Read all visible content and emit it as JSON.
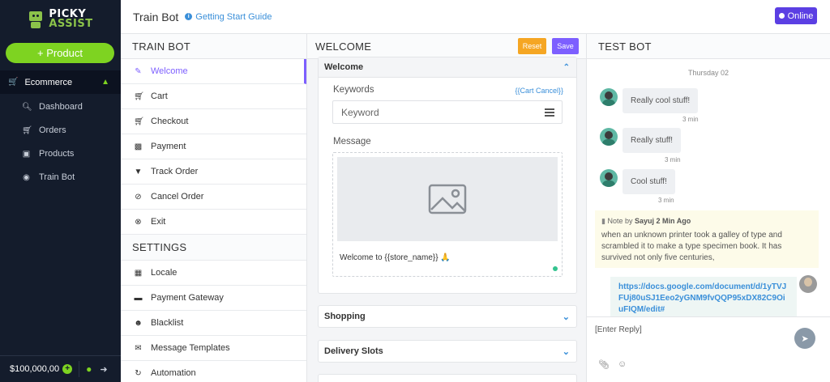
{
  "sidebar": {
    "brand_line1": "PICKY",
    "brand_line2": "ASSIST",
    "add_product_label": "+ Product",
    "section_label": "Ecommerce",
    "items": [
      {
        "label": "Dashboard",
        "icon": "search-icon"
      },
      {
        "label": "Orders",
        "icon": "cart-icon"
      },
      {
        "label": "Products",
        "icon": "briefcase-icon"
      },
      {
        "label": "Train Bot",
        "icon": "android-icon"
      }
    ],
    "balance": "$100,000,00"
  },
  "topbar": {
    "title": "Train Bot",
    "guide_label": "Getting Start Guide",
    "status_label": "Online"
  },
  "train_panel": {
    "heading": "TRAIN BOT",
    "items": [
      {
        "label": "Welcome",
        "icon": "edit-icon",
        "active": true
      },
      {
        "label": "Cart",
        "icon": "cart-icon"
      },
      {
        "label": "Checkout",
        "icon": "cart-icon"
      },
      {
        "label": "Payment",
        "icon": "money-icon"
      },
      {
        "label": "Track Order",
        "icon": "map-marker-icon"
      },
      {
        "label": "Cancel Order",
        "icon": "ban-icon"
      },
      {
        "label": "Exit",
        "icon": "times-circle-icon"
      }
    ],
    "settings_heading": "SETTINGS",
    "settings_items": [
      {
        "label": "Locale",
        "icon": "map-icon"
      },
      {
        "label": "Payment Gateway",
        "icon": "credit-card-icon"
      },
      {
        "label": "Blacklist",
        "icon": "user-block-icon"
      },
      {
        "label": "Message Templates",
        "icon": "comments-icon"
      },
      {
        "label": "Automation",
        "icon": "refresh-icon"
      }
    ]
  },
  "welcome_panel": {
    "heading": "WELCOME",
    "reset_label": "Reset",
    "save_label": "Save",
    "card_title": "Welcome",
    "keywords_label": "Keywords",
    "keywords_link": "{{Cart Cancel}}",
    "keyword_placeholder": "Keyword",
    "message_label": "Message",
    "message_text": "Welcome to {{store_name}} 🙏",
    "sections": [
      "Shopping",
      "Delivery Slots"
    ]
  },
  "test_panel": {
    "heading": "TEST BOT",
    "day_label": "Thursday 02",
    "messages": [
      {
        "text": "Really cool stuff!",
        "time": "3 min"
      },
      {
        "text": "Really stuff!",
        "time": "3 min"
      },
      {
        "text": "Cool stuff!",
        "time": "3 min"
      }
    ],
    "note": {
      "prefix": "Note by",
      "author": "Sayuj",
      "ago": "2 Min Ago",
      "text": "when an unknown printer took a galley of type and scrambled it to make a type specimen book. It has survived not only five centuries,"
    },
    "link_text": "https://docs.google.com/document/d/1yTVJFUj80uSJ1Eeo2yGNM9fvQQP95xDX82C9OiuFIQM/edit#",
    "reply_placeholder": "[Enter Reply]"
  },
  "colors": {
    "sidebar_bg": "#141c2c",
    "accent_green": "#7ed321",
    "accent_purple": "#7d5fff",
    "online_purple": "#5b3fe3",
    "reset_orange": "#f5a623",
    "link_blue": "#3a8fd9"
  }
}
